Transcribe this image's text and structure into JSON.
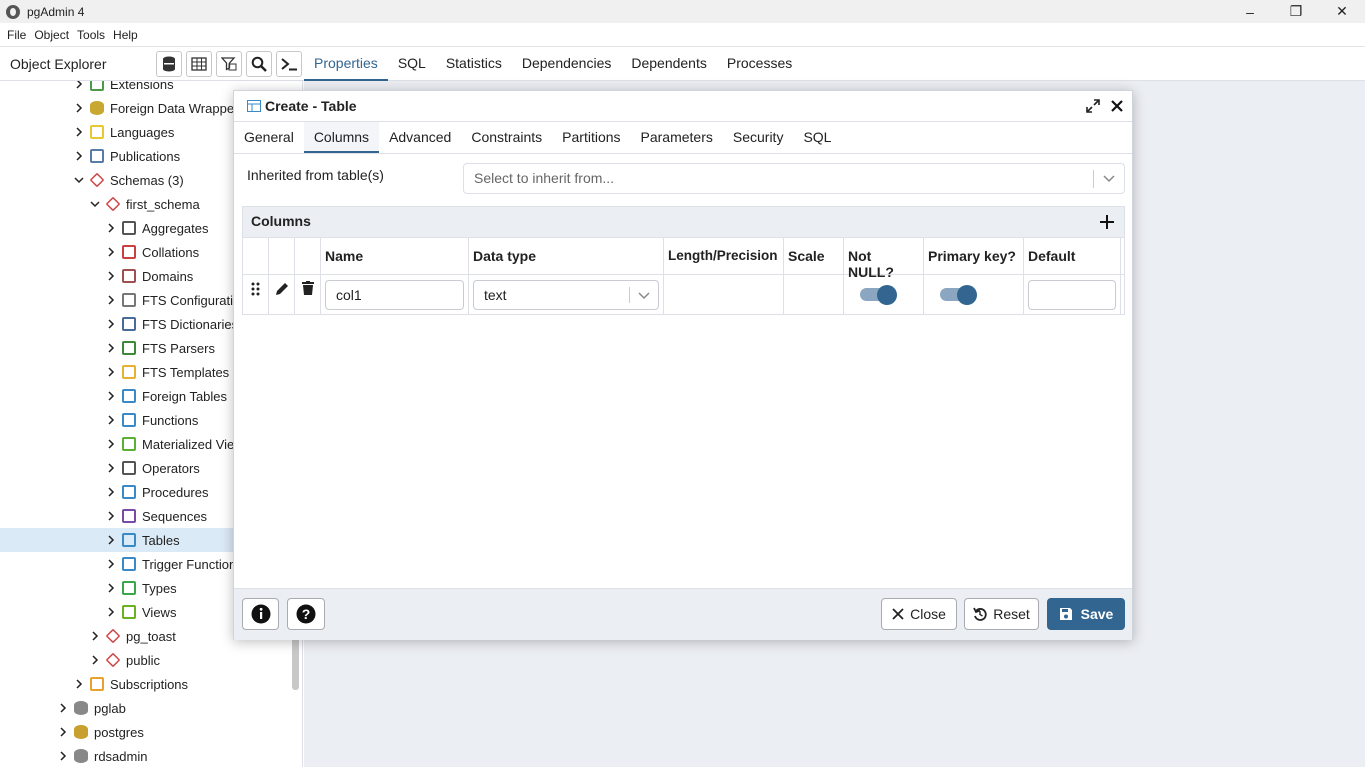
{
  "window": {
    "title": "pgAdmin 4",
    "controls": [
      "–",
      "❐",
      "✕"
    ]
  },
  "menu": [
    "File",
    "Object",
    "Tools",
    "Help"
  ],
  "object_explorer": {
    "title": "Object Explorer"
  },
  "main_tabs": [
    "Properties",
    "SQL",
    "Statistics",
    "Dependencies",
    "Dependents",
    "Processes"
  ],
  "tree": [
    {
      "label": "Extensions",
      "icon": "extensions-icon",
      "color": "#4a9a4a"
    },
    {
      "label": "Foreign Data Wrappers",
      "icon": "fdw-icon",
      "color": "#c8a830"
    },
    {
      "label": "Languages",
      "icon": "languages-icon",
      "color": "#e8c830"
    },
    {
      "label": "Publications",
      "icon": "publications-icon",
      "color": "#5a7aa8"
    },
    {
      "label": "Schemas (3)",
      "icon": "schemas-icon",
      "color": "#d04848"
    },
    {
      "label": "first_schema",
      "icon": "schema-icon",
      "color": "#d04848"
    },
    {
      "label": "Aggregates",
      "icon": "aggregates-icon",
      "color": "#555555"
    },
    {
      "label": "Collations",
      "icon": "collations-icon",
      "color": "#c84040"
    },
    {
      "label": "Domains",
      "icon": "domains-icon",
      "color": "#a05050"
    },
    {
      "label": "FTS Configurations",
      "icon": "fts-config-icon",
      "color": "#777777"
    },
    {
      "label": "FTS Dictionaries",
      "icon": "fts-dict-icon",
      "color": "#4a6a9a"
    },
    {
      "label": "FTS Parsers",
      "icon": "fts-parsers-icon",
      "color": "#3a8a3a"
    },
    {
      "label": "FTS Templates",
      "icon": "fts-templates-icon",
      "color": "#e8b030"
    },
    {
      "label": "Foreign Tables",
      "icon": "foreign-tables-icon",
      "color": "#3a8ac8"
    },
    {
      "label": "Functions",
      "icon": "functions-icon",
      "color": "#3a8ac8"
    },
    {
      "label": "Materialized Views",
      "icon": "matviews-icon",
      "color": "#5ab030"
    },
    {
      "label": "Operators",
      "icon": "operators-icon",
      "color": "#555555"
    },
    {
      "label": "Procedures",
      "icon": "procedures-icon",
      "color": "#3a8ac8"
    },
    {
      "label": "Sequences",
      "icon": "sequences-icon",
      "color": "#7a4aa8"
    },
    {
      "label": "Tables",
      "icon": "tables-icon",
      "color": "#3a8ac8"
    },
    {
      "label": "Trigger Functions",
      "icon": "trigger-functions-icon",
      "color": "#3a8ac8"
    },
    {
      "label": "Types",
      "icon": "types-icon",
      "color": "#3aa84a"
    },
    {
      "label": "Views",
      "icon": "views-icon",
      "color": "#6ab020"
    },
    {
      "label": "pg_toast",
      "icon": "schema-icon",
      "color": "#d04848"
    },
    {
      "label": "public",
      "icon": "schema-icon",
      "color": "#d04848"
    },
    {
      "label": "Subscriptions",
      "icon": "subscriptions-icon",
      "color": "#e8a030"
    },
    {
      "label": "pglab",
      "icon": "database-icon",
      "color": "#888888"
    },
    {
      "label": "postgres",
      "icon": "database-icon",
      "color": "#c8a030"
    },
    {
      "label": "rdsadmin",
      "icon": "database-icon",
      "color": "#888888"
    }
  ],
  "dialog": {
    "title": "Create - Table",
    "tabs": [
      "General",
      "Columns",
      "Advanced",
      "Constraints",
      "Partitions",
      "Parameters",
      "Security",
      "SQL"
    ],
    "active_tab": "Columns",
    "inherit_label": "Inherited from table(s)",
    "inherit_placeholder": "Select to inherit from...",
    "columns_label": "Columns",
    "headers": [
      "Name",
      "Data type",
      "Length/Precision",
      "Scale",
      "Not NULL?",
      "Primary key?",
      "Default"
    ],
    "row": {
      "name": "col1",
      "data_type": "text",
      "length": "",
      "scale": "",
      "not_null": true,
      "primary_key": true,
      "default": ""
    },
    "footer": {
      "close": "Close",
      "reset": "Reset",
      "save": "Save"
    }
  },
  "colors": {
    "accent": "#326690",
    "selection": "#dbeaf7",
    "panel_bg": "#ebeef3"
  }
}
